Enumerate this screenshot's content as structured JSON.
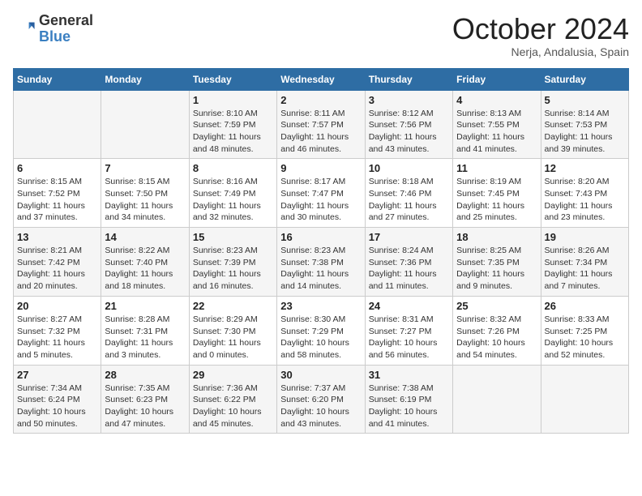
{
  "header": {
    "logo_general": "General",
    "logo_blue": "Blue",
    "month_title": "October 2024",
    "subtitle": "Nerja, Andalusia, Spain"
  },
  "days_of_week": [
    "Sunday",
    "Monday",
    "Tuesday",
    "Wednesday",
    "Thursday",
    "Friday",
    "Saturday"
  ],
  "weeks": [
    [
      {
        "day": "",
        "info": ""
      },
      {
        "day": "",
        "info": ""
      },
      {
        "day": "1",
        "info": "Sunrise: 8:10 AM\nSunset: 7:59 PM\nDaylight: 11 hours and 48 minutes."
      },
      {
        "day": "2",
        "info": "Sunrise: 8:11 AM\nSunset: 7:57 PM\nDaylight: 11 hours and 46 minutes."
      },
      {
        "day": "3",
        "info": "Sunrise: 8:12 AM\nSunset: 7:56 PM\nDaylight: 11 hours and 43 minutes."
      },
      {
        "day": "4",
        "info": "Sunrise: 8:13 AM\nSunset: 7:55 PM\nDaylight: 11 hours and 41 minutes."
      },
      {
        "day": "5",
        "info": "Sunrise: 8:14 AM\nSunset: 7:53 PM\nDaylight: 11 hours and 39 minutes."
      }
    ],
    [
      {
        "day": "6",
        "info": "Sunrise: 8:15 AM\nSunset: 7:52 PM\nDaylight: 11 hours and 37 minutes."
      },
      {
        "day": "7",
        "info": "Sunrise: 8:15 AM\nSunset: 7:50 PM\nDaylight: 11 hours and 34 minutes."
      },
      {
        "day": "8",
        "info": "Sunrise: 8:16 AM\nSunset: 7:49 PM\nDaylight: 11 hours and 32 minutes."
      },
      {
        "day": "9",
        "info": "Sunrise: 8:17 AM\nSunset: 7:47 PM\nDaylight: 11 hours and 30 minutes."
      },
      {
        "day": "10",
        "info": "Sunrise: 8:18 AM\nSunset: 7:46 PM\nDaylight: 11 hours and 27 minutes."
      },
      {
        "day": "11",
        "info": "Sunrise: 8:19 AM\nSunset: 7:45 PM\nDaylight: 11 hours and 25 minutes."
      },
      {
        "day": "12",
        "info": "Sunrise: 8:20 AM\nSunset: 7:43 PM\nDaylight: 11 hours and 23 minutes."
      }
    ],
    [
      {
        "day": "13",
        "info": "Sunrise: 8:21 AM\nSunset: 7:42 PM\nDaylight: 11 hours and 20 minutes."
      },
      {
        "day": "14",
        "info": "Sunrise: 8:22 AM\nSunset: 7:40 PM\nDaylight: 11 hours and 18 minutes."
      },
      {
        "day": "15",
        "info": "Sunrise: 8:23 AM\nSunset: 7:39 PM\nDaylight: 11 hours and 16 minutes."
      },
      {
        "day": "16",
        "info": "Sunrise: 8:23 AM\nSunset: 7:38 PM\nDaylight: 11 hours and 14 minutes."
      },
      {
        "day": "17",
        "info": "Sunrise: 8:24 AM\nSunset: 7:36 PM\nDaylight: 11 hours and 11 minutes."
      },
      {
        "day": "18",
        "info": "Sunrise: 8:25 AM\nSunset: 7:35 PM\nDaylight: 11 hours and 9 minutes."
      },
      {
        "day": "19",
        "info": "Sunrise: 8:26 AM\nSunset: 7:34 PM\nDaylight: 11 hours and 7 minutes."
      }
    ],
    [
      {
        "day": "20",
        "info": "Sunrise: 8:27 AM\nSunset: 7:32 PM\nDaylight: 11 hours and 5 minutes."
      },
      {
        "day": "21",
        "info": "Sunrise: 8:28 AM\nSunset: 7:31 PM\nDaylight: 11 hours and 3 minutes."
      },
      {
        "day": "22",
        "info": "Sunrise: 8:29 AM\nSunset: 7:30 PM\nDaylight: 11 hours and 0 minutes."
      },
      {
        "day": "23",
        "info": "Sunrise: 8:30 AM\nSunset: 7:29 PM\nDaylight: 10 hours and 58 minutes."
      },
      {
        "day": "24",
        "info": "Sunrise: 8:31 AM\nSunset: 7:27 PM\nDaylight: 10 hours and 56 minutes."
      },
      {
        "day": "25",
        "info": "Sunrise: 8:32 AM\nSunset: 7:26 PM\nDaylight: 10 hours and 54 minutes."
      },
      {
        "day": "26",
        "info": "Sunrise: 8:33 AM\nSunset: 7:25 PM\nDaylight: 10 hours and 52 minutes."
      }
    ],
    [
      {
        "day": "27",
        "info": "Sunrise: 7:34 AM\nSunset: 6:24 PM\nDaylight: 10 hours and 50 minutes."
      },
      {
        "day": "28",
        "info": "Sunrise: 7:35 AM\nSunset: 6:23 PM\nDaylight: 10 hours and 47 minutes."
      },
      {
        "day": "29",
        "info": "Sunrise: 7:36 AM\nSunset: 6:22 PM\nDaylight: 10 hours and 45 minutes."
      },
      {
        "day": "30",
        "info": "Sunrise: 7:37 AM\nSunset: 6:20 PM\nDaylight: 10 hours and 43 minutes."
      },
      {
        "day": "31",
        "info": "Sunrise: 7:38 AM\nSunset: 6:19 PM\nDaylight: 10 hours and 41 minutes."
      },
      {
        "day": "",
        "info": ""
      },
      {
        "day": "",
        "info": ""
      }
    ]
  ]
}
